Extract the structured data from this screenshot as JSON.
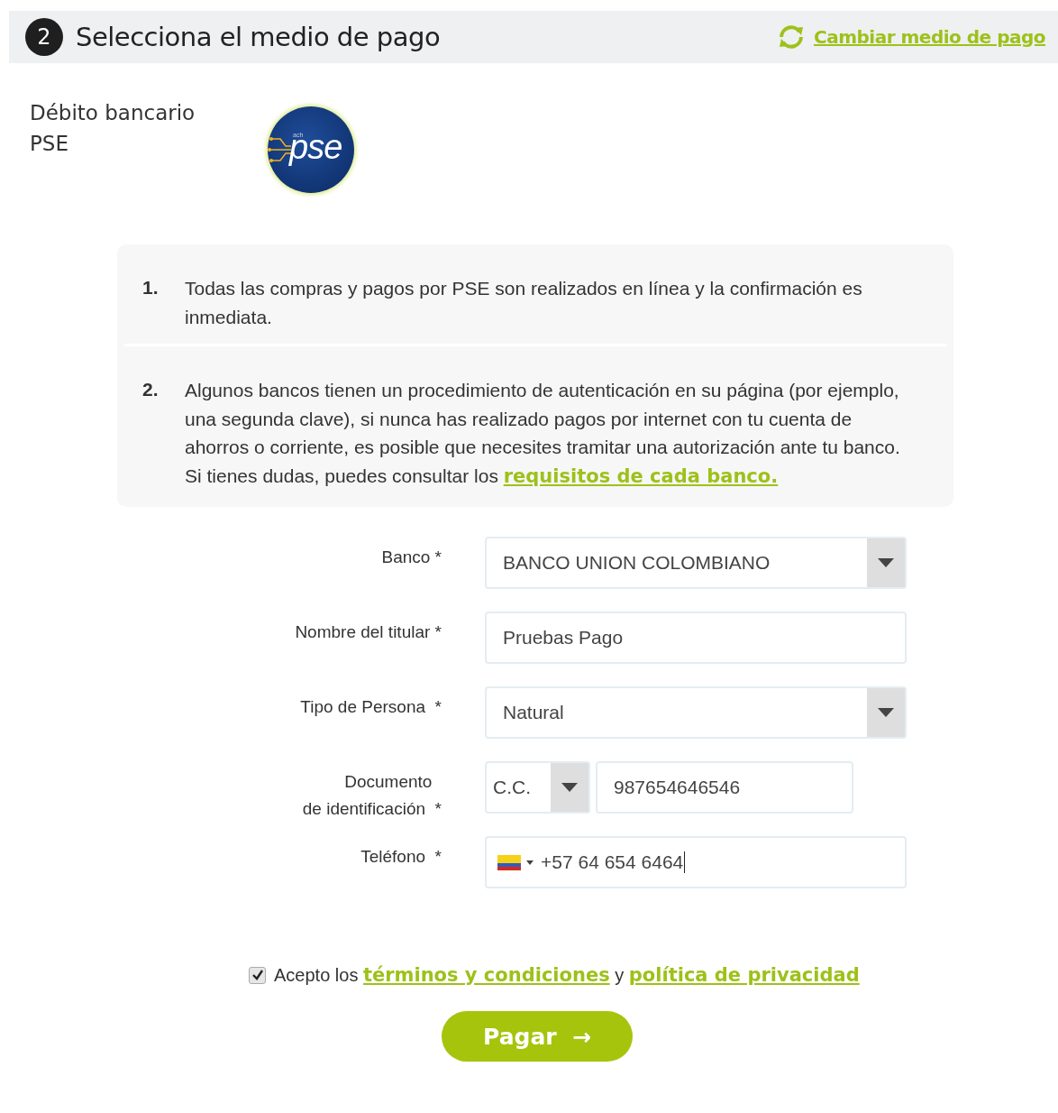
{
  "header": {
    "step": "2",
    "title": "Selecciona el medio de pago",
    "change_link": "Cambiar medio de pago"
  },
  "method": {
    "name_lines": [
      "Débito bancario",
      "PSE"
    ],
    "logo_small": "ach",
    "logo_text": "pse"
  },
  "notes": [
    {
      "number": "1.",
      "text": "Todas las compras y pagos por PSE son realizados en línea y la confirmación es inmediata."
    },
    {
      "number": "2.",
      "text": "Algunos bancos tienen un procedimiento de autenticación en su página (por ejemplo, una segunda clave), si nunca has realizado pagos por internet con tu cuenta de ahorros o corriente, es posible que necesites tramitar una autorización ante tu banco. Si tienes dudas, puedes consultar los",
      "link": "requisitos de cada banco."
    }
  ],
  "form": [
    {
      "kind": "select",
      "label_lines": [
        "Banco *"
      ],
      "value": "BANCO UNION COLOMBIANO"
    },
    {
      "kind": "text",
      "label_lines": [
        "Nombre del titular *"
      ],
      "value": "Pruebas Pago"
    },
    {
      "kind": "select",
      "label_lines": [
        "Tipo de Persona  *"
      ],
      "value": "Natural"
    },
    {
      "kind": "document",
      "label_lines": [
        "Documento  ",
        "de identificación  *"
      ],
      "doc_type": "C.C.",
      "value": "987654646546"
    },
    {
      "kind": "phone",
      "label_lines": [
        "Teléfono  *"
      ],
      "value": "+57 64 654 6464"
    }
  ],
  "terms": {
    "checked": true,
    "prefix": "Acepto los",
    "link1": "términos y condiciones",
    "joiner": "y",
    "link2": "política de privacidad"
  },
  "submit": {
    "label": "Pagar",
    "arrow": "→"
  }
}
